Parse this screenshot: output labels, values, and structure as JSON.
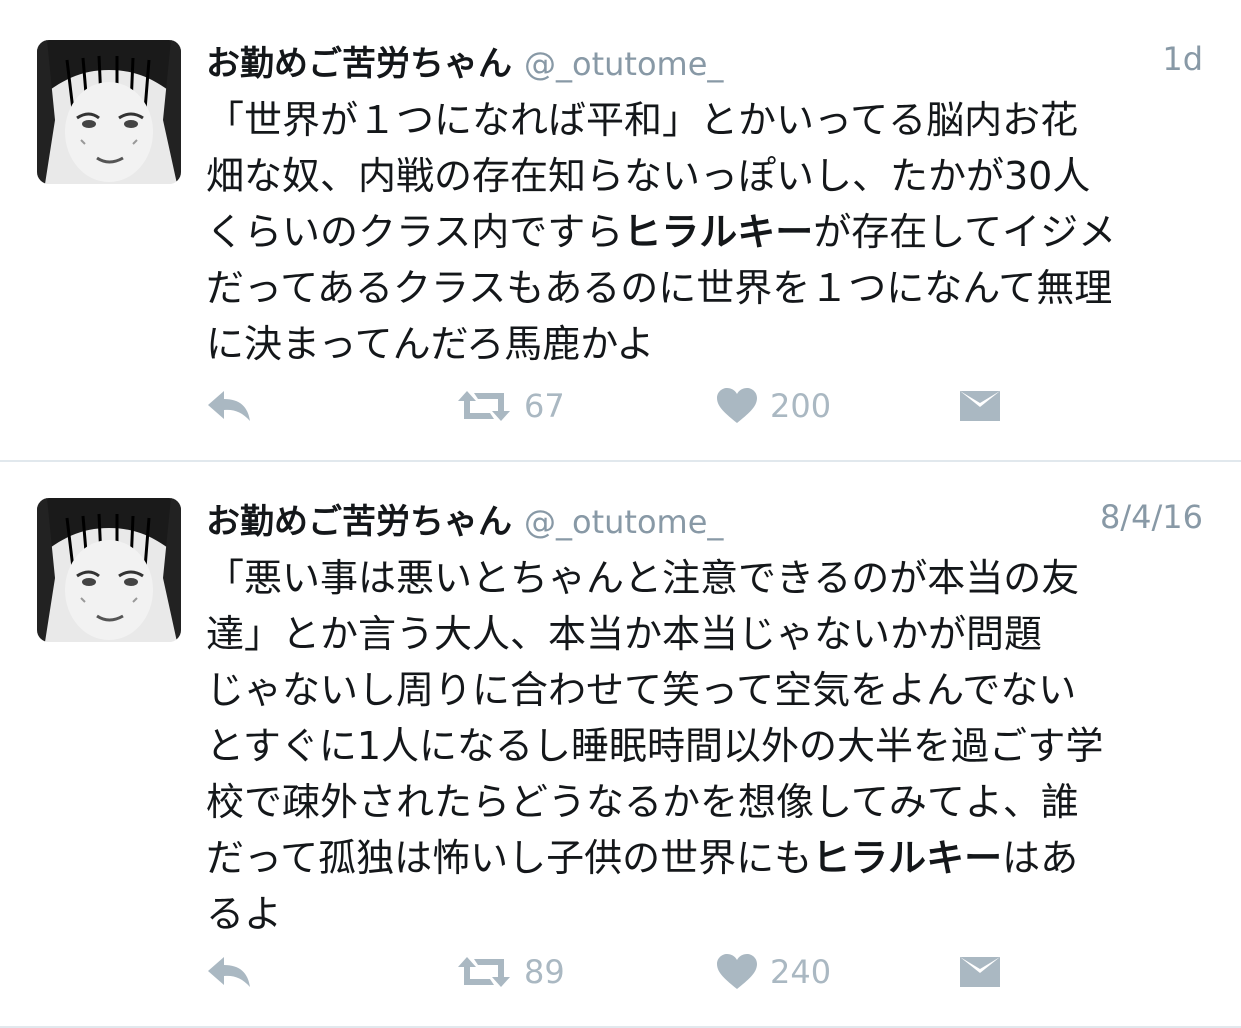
{
  "tweets": [
    {
      "name": "お勤めご苦労ちゃん",
      "handle": "@_otutome_",
      "time": "1d",
      "lines": [
        [
          "「世界が１つになれば平和」とかいってる脳内お花"
        ],
        [
          "畑な奴、内戦の存在知らないっぽいし、たかが30人"
        ],
        [
          "くらいのクラス内ですら",
          "ヒラルキー",
          "が存在してイジメ"
        ],
        [
          "だってあるクラスもあるのに世界を１つになんて無理"
        ],
        [
          "に決まってんだろ馬鹿かよ"
        ]
      ],
      "retweets": "67",
      "likes": "200"
    },
    {
      "name": "お勤めご苦労ちゃん",
      "handle": "@_otutome_",
      "time": "8/4/16",
      "lines": [
        [
          "「悪い事は悪いとちゃんと注意できるのが本当の友"
        ],
        [
          "達」とか言う大人、本当か本当じゃないかが問題"
        ],
        [
          "じゃないし周りに合わせて笑って空気をよんでない"
        ],
        [
          "とすぐに1人になるし睡眠時間以外の大半を過ごす学"
        ],
        [
          "校で疎外されたらどうなるかを想像してみてよ、誰"
        ],
        [
          "だって孤独は怖いし子供の世界にも",
          "ヒラルキー",
          "はあ"
        ],
        [
          "るよ"
        ]
      ],
      "retweets": "89",
      "likes": "240"
    }
  ],
  "icons": {
    "reply": "reply-icon",
    "retweet": "retweet-icon",
    "like": "heart-icon",
    "dm": "envelope-icon"
  },
  "colors": {
    "text": "#14171a",
    "muted": "#8899a6",
    "icon": "#aab8c2",
    "divider": "#e1e8ed"
  }
}
